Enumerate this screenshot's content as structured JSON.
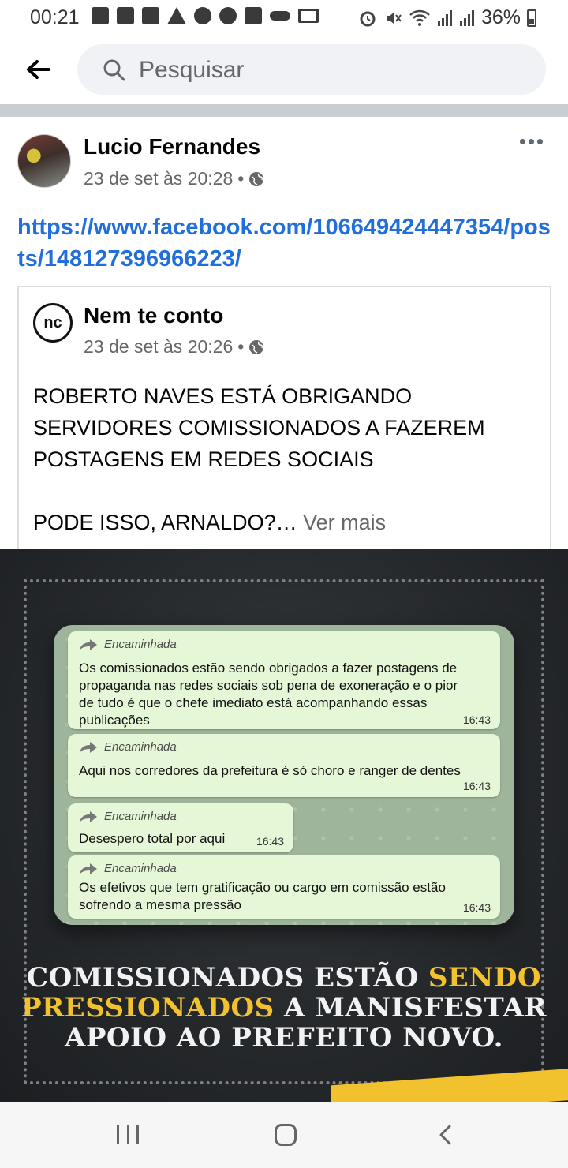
{
  "status_bar": {
    "time": "00:21",
    "battery": "36%",
    "left_icons": [
      "voicemail-icon",
      "voicemail-icon",
      "message-icon",
      "warning-icon",
      "alert-icon",
      "alert-icon",
      "gallery-icon",
      "key-icon",
      "laptop-icon"
    ],
    "right_icons": [
      "alarm-icon",
      "mute-icon",
      "wifi-icon",
      "signal-icon",
      "signal-icon",
      "battery-icon"
    ]
  },
  "search": {
    "placeholder": "Pesquisar"
  },
  "post": {
    "author": "Lucio Fernandes",
    "timestamp": "23 de set às 20:28",
    "separator": "•",
    "link": "https://www.facebook.com/106649424447354/posts/148127396966223/",
    "shared": {
      "page_name": "Nem te conto",
      "avatar_text": "nc",
      "timestamp": "23 de set às 20:26",
      "text_lines": [
        "ROBERTO NAVES ESTÁ OBRIGANDO",
        "SERVIDORES COMISSIONADOS A FAZEREM",
        "POSTAGENS EM REDES SOCIAIS"
      ],
      "second_paragraph": "PODE ISSO, ARNALDO?…",
      "see_more": "Ver mais"
    }
  },
  "image": {
    "messages": [
      {
        "forwarded": "Encaminhada",
        "lines": [
          "Os comissionados estão sendo obrigados a fazer postagens de",
          "propaganda nas redes sociais sob pena de exoneração e o pior",
          "de tudo é que o chefe imediato está acompanhando essas",
          "publicações"
        ],
        "time": "16:43"
      },
      {
        "forwarded": "Encaminhada",
        "lines": [
          "Aqui nos corredores da prefeitura é só choro e ranger de dentes"
        ],
        "time": "16:43"
      },
      {
        "forwarded": "Encaminhada",
        "lines": [
          "Desespero total por aqui"
        ],
        "time": "16:43"
      },
      {
        "forwarded": "Encaminhada",
        "lines": [
          "Os efetivos que tem gratificação ou cargo em comissão estão",
          "sofrendo a mesma pressão"
        ],
        "time": "16:43"
      }
    ],
    "headline": {
      "line1_a": "COMISSIONADOS ESTÃO ",
      "line1_b": "SENDO",
      "line2_a": "PRESSIONADOS",
      "line2_b": " A MANISFESTAR",
      "line3": "APOIO AO PREFEITO NOVO."
    },
    "colors": {
      "highlight": "#f2c12e",
      "text": "#f2f2f2",
      "bubble": "#e6f7d8"
    }
  },
  "colors": {
    "link": "#216fdb",
    "secondary_text": "#65676b",
    "search_bg": "#f0f2f5"
  }
}
